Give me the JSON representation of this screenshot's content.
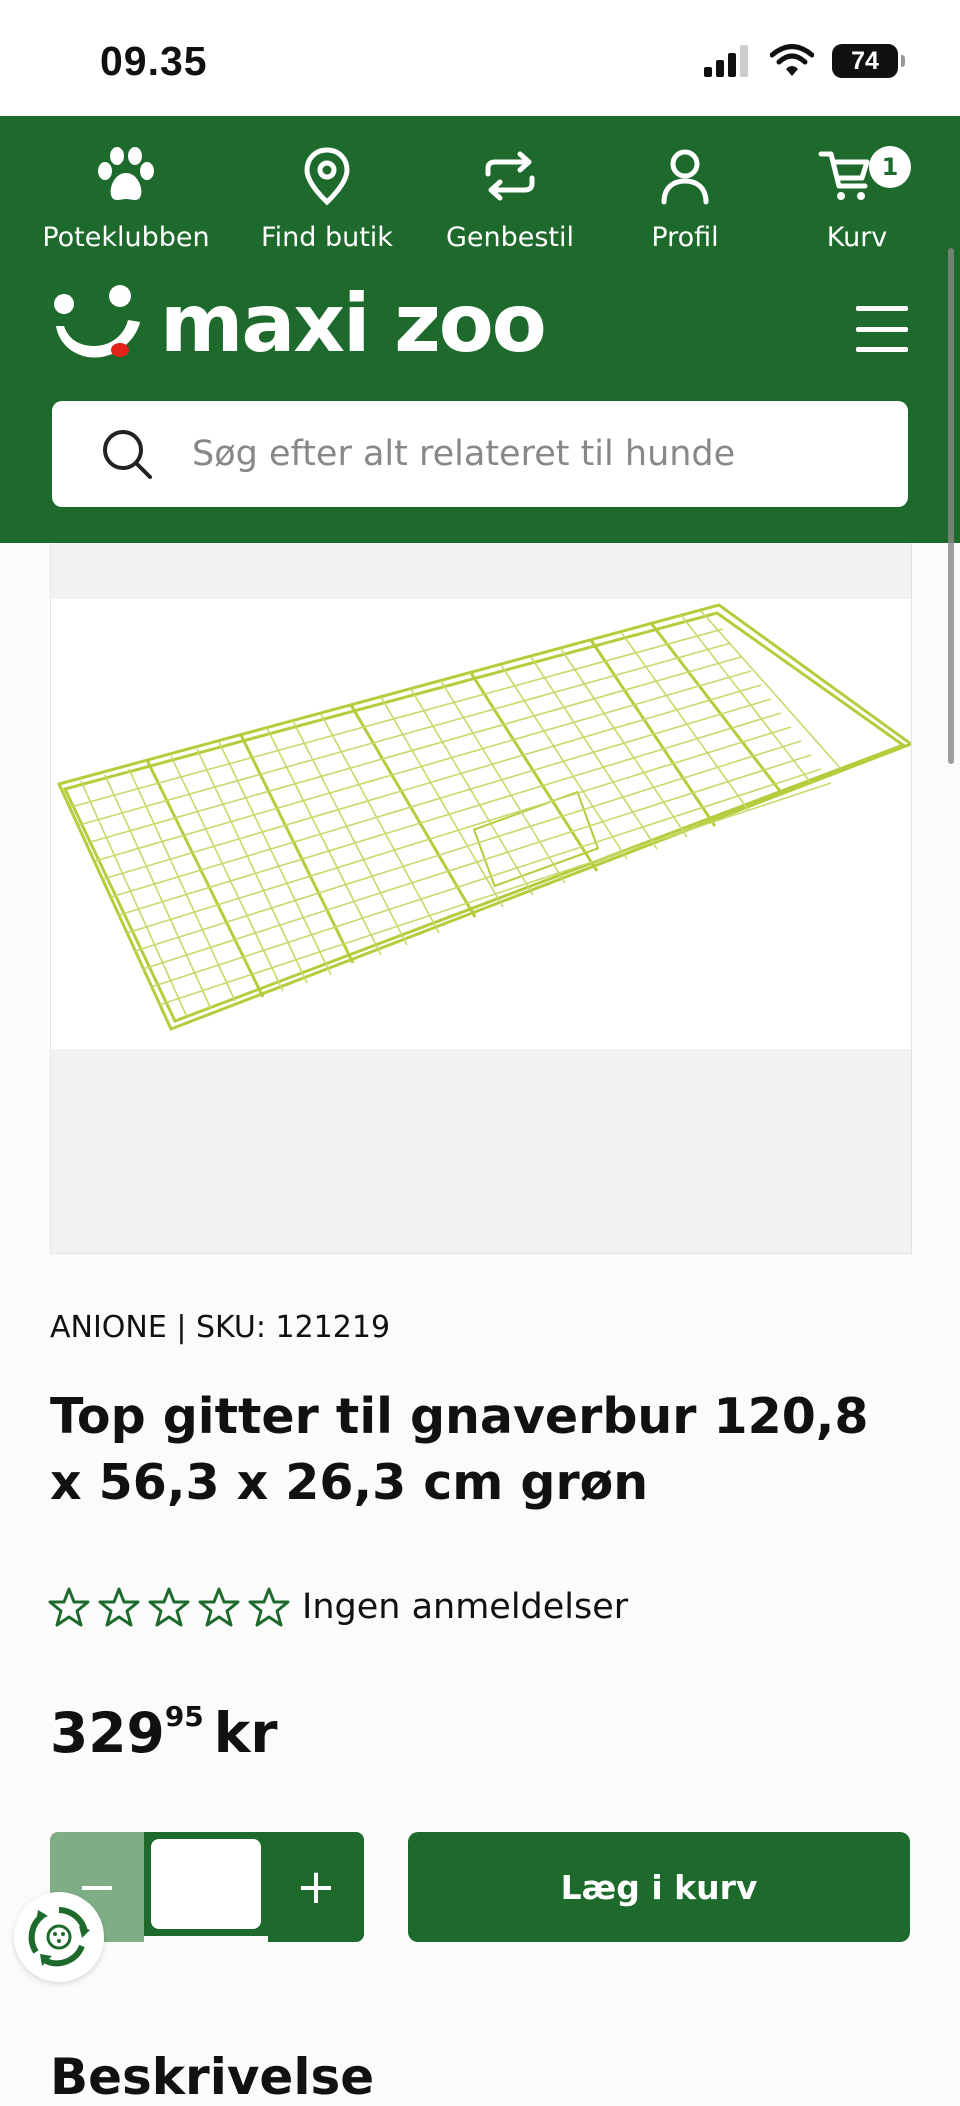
{
  "status_bar": {
    "time": "09.35",
    "battery": "74"
  },
  "topnav": [
    {
      "label": "Poteklubben",
      "icon": "paw-icon"
    },
    {
      "label": "Find butik",
      "icon": "location-pin-icon"
    },
    {
      "label": "Genbestil",
      "icon": "reorder-icon"
    },
    {
      "label": "Profil",
      "icon": "user-icon"
    },
    {
      "label": "Kurv",
      "icon": "cart-icon",
      "badge": "1"
    }
  ],
  "brand": {
    "name": "maxi zoo",
    "color": "#1e6a2c"
  },
  "search": {
    "placeholder": "Søg efter alt relateret til hunde"
  },
  "product": {
    "meta": "ANIONE | SKU: 121219",
    "title": "Top gitter til gnaverbur 120,8 x 56,3 x 26,3 cm grøn",
    "rating": {
      "stars": 0,
      "max": 5,
      "text": "Ingen anmeldelser"
    },
    "price": {
      "major": "329",
      "minor": "95",
      "currency": "kr"
    }
  },
  "cart": {
    "minus": "−",
    "plus": "+",
    "quantity": "",
    "add_label": "Læg i kurv"
  },
  "next_section_heading": "Beskrivelse"
}
